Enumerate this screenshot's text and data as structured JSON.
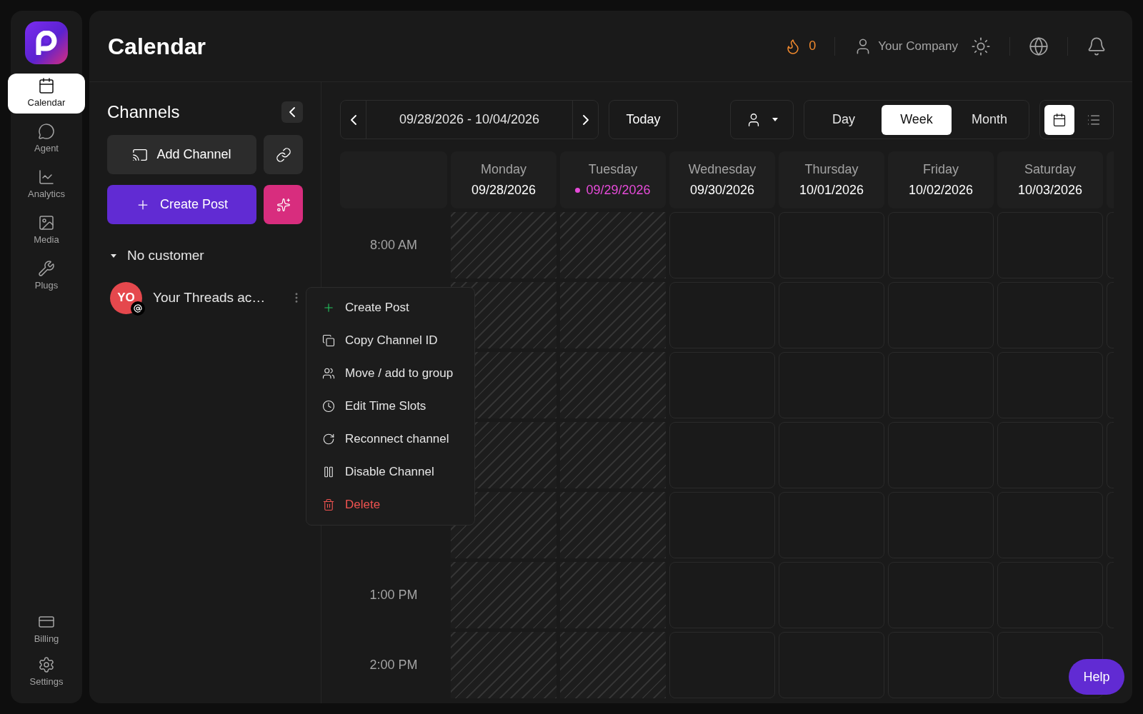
{
  "nav": {
    "items": [
      {
        "kind": "calendar",
        "label": "Calendar",
        "selected": true
      },
      {
        "kind": "agent",
        "label": "Agent",
        "selected": false
      },
      {
        "kind": "analytics",
        "label": "Analytics",
        "selected": false
      },
      {
        "kind": "media",
        "label": "Media",
        "selected": false
      },
      {
        "kind": "plugs",
        "label": "Plugs",
        "selected": false
      }
    ],
    "bottom_items": [
      {
        "kind": "billing",
        "label": "Billing",
        "selected": false
      },
      {
        "kind": "settings",
        "label": "Settings",
        "selected": false
      }
    ]
  },
  "header": {
    "title": "Calendar",
    "streak": "0",
    "company": "Your Company"
  },
  "channels": {
    "title": "Channels",
    "add_channel": "Add Channel",
    "create_post": "Create Post",
    "group": {
      "label": "No customer",
      "expanded": true
    },
    "items": [
      {
        "initials": "YO",
        "name": "Your Threads ac…"
      }
    ]
  },
  "toolbar": {
    "date_range": "09/28/2026 - 10/04/2026",
    "today": "Today",
    "views": [
      {
        "label": "Day",
        "selected": false
      },
      {
        "label": "Week",
        "selected": true
      },
      {
        "label": "Month",
        "selected": false
      }
    ],
    "display": [
      {
        "kind": "calendar",
        "selected": true
      },
      {
        "kind": "list",
        "selected": false
      }
    ]
  },
  "days": [
    {
      "weekday": "Monday",
      "date": "09/28/2026",
      "today": false,
      "past": true
    },
    {
      "weekday": "Tuesday",
      "date": "09/29/2026",
      "today": true,
      "past": true
    },
    {
      "weekday": "Wednesday",
      "date": "09/30/2026",
      "today": false,
      "past": false
    },
    {
      "weekday": "Thursday",
      "date": "10/01/2026",
      "today": false,
      "past": false
    },
    {
      "weekday": "Friday",
      "date": "10/02/2026",
      "today": false,
      "past": false
    },
    {
      "weekday": "Saturday",
      "date": "10/03/2026",
      "today": false,
      "past": false
    }
  ],
  "rows": [
    {
      "time": "8:00 AM"
    },
    {},
    {},
    {},
    {},
    {
      "time": "1:00 PM"
    },
    {
      "time": "2:00 PM"
    }
  ],
  "context_menu": {
    "items": [
      {
        "kind": "create",
        "label": "Create Post"
      },
      {
        "kind": "copy",
        "label": "Copy Channel ID"
      },
      {
        "kind": "group",
        "label": "Move / add to group"
      },
      {
        "kind": "time",
        "label": "Edit Time Slots"
      },
      {
        "kind": "reconnect",
        "label": "Reconnect channel"
      },
      {
        "kind": "disable",
        "label": "Disable Channel"
      },
      {
        "kind": "delete",
        "label": "Delete"
      }
    ]
  },
  "help": "Help"
}
